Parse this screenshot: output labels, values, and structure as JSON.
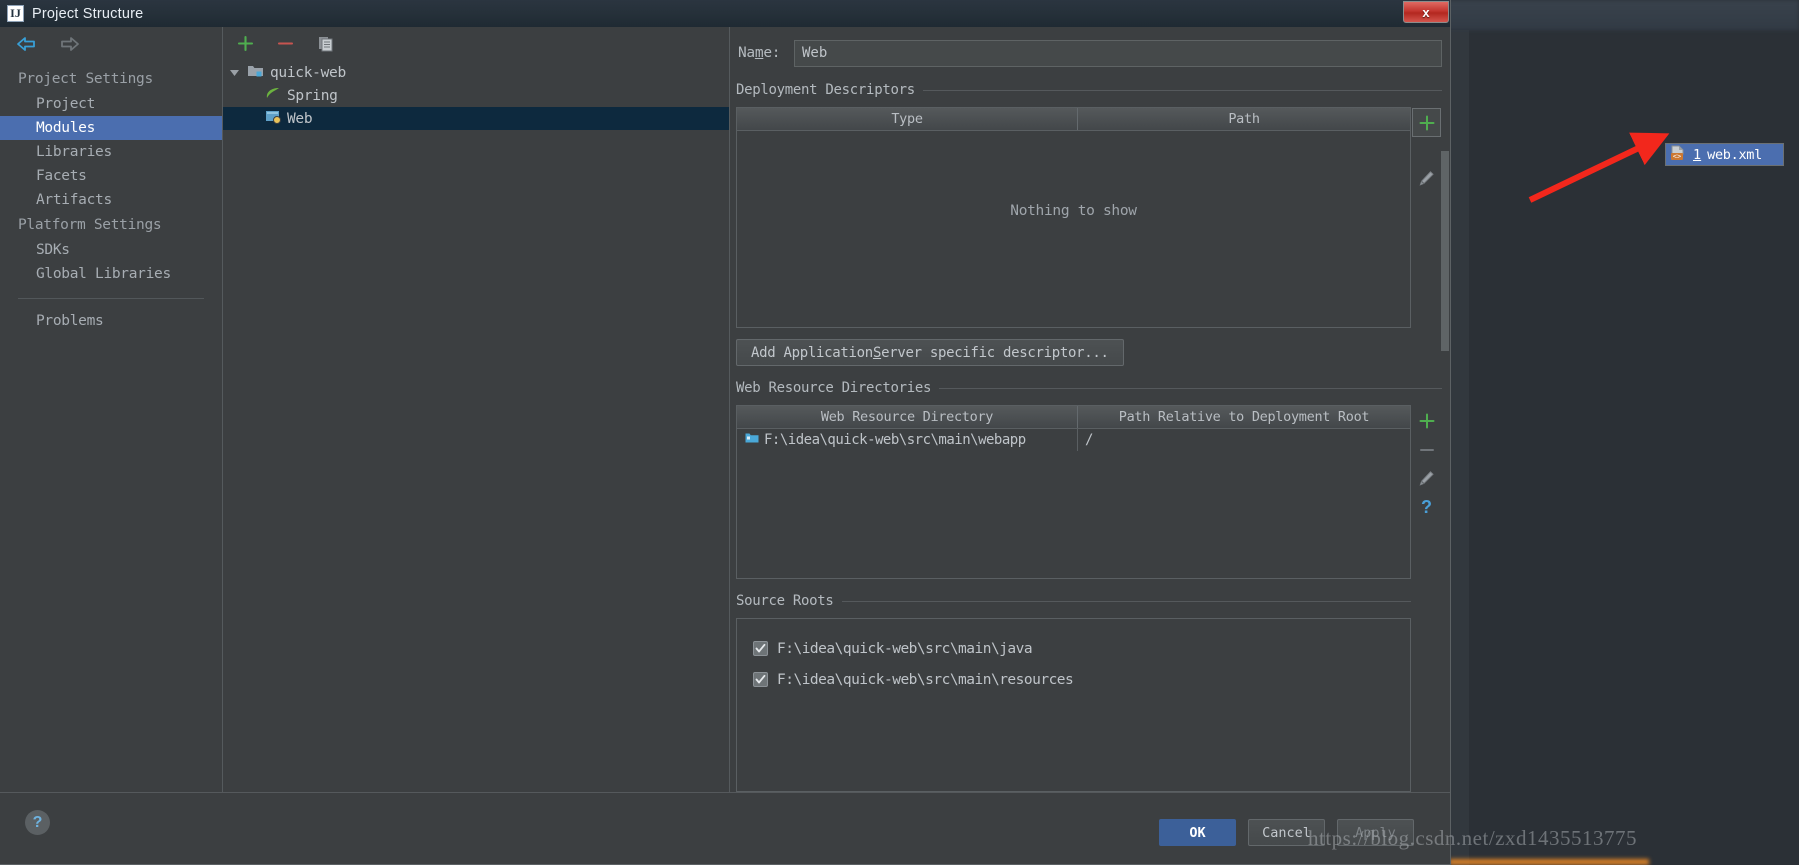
{
  "window": {
    "title": "Project Structure",
    "icon": "idea-logo-icon",
    "close_label": "x"
  },
  "sidebar": {
    "back_icon": "back-arrow-icon",
    "forward_icon": "forward-arrow-icon",
    "groups": [
      {
        "label": "Project Settings",
        "items": [
          {
            "label": "Project",
            "selected": false
          },
          {
            "label": "Modules",
            "selected": true
          },
          {
            "label": "Libraries",
            "selected": false
          },
          {
            "label": "Facets",
            "selected": false
          },
          {
            "label": "Artifacts",
            "selected": false
          }
        ]
      },
      {
        "label": "Platform Settings",
        "items": [
          {
            "label": "SDKs",
            "selected": false
          },
          {
            "label": "Global Libraries",
            "selected": false
          }
        ]
      }
    ],
    "extra": [
      {
        "label": "Problems",
        "selected": false
      }
    ]
  },
  "tree": {
    "toolbar": [
      {
        "name": "add-module-button",
        "icon": "plus-icon"
      },
      {
        "name": "remove-module-button",
        "icon": "minus-icon"
      },
      {
        "name": "copy-module-button",
        "icon": "copy-icon"
      }
    ],
    "nodes": [
      {
        "label": "quick-web",
        "icon": "module-folder-icon",
        "indent": 0,
        "expanded": true,
        "selected": false
      },
      {
        "label": "Spring",
        "icon": "spring-leaf-icon",
        "indent": 1,
        "selected": false
      },
      {
        "label": "Web",
        "icon": "web-facet-icon",
        "indent": 1,
        "selected": true
      }
    ]
  },
  "detail": {
    "name_label_pre": "Na",
    "name_label_accel": "m",
    "name_label_post": "e:",
    "name_value": "Web",
    "name_placeholder": "",
    "deployment": {
      "title": "Deployment Descriptors",
      "columns": [
        "Type",
        "Path"
      ],
      "rows": [],
      "empty_message": "Nothing to show",
      "tools": [
        {
          "name": "add-descriptor-button",
          "icon": "plus-icon"
        },
        {
          "name": "edit-descriptor-button",
          "icon": "pencil-icon"
        }
      ]
    },
    "add_descriptor_button": {
      "pre": "Add Application ",
      "accel": "S",
      "post": "erver specific descriptor..."
    },
    "web_resources": {
      "title": "Web Resource Directories",
      "columns": [
        "Web Resource Directory",
        "Path Relative to Deployment Root"
      ],
      "rows": [
        {
          "directory": "F:\\idea\\quick-web\\src\\main\\webapp",
          "relative_path": "/",
          "icon": "folder-blue-icon"
        }
      ],
      "tools": [
        {
          "name": "add-web-resource-button",
          "icon": "plus-icon"
        },
        {
          "name": "remove-web-resource-button",
          "icon": "minus-icon"
        },
        {
          "name": "edit-web-resource-button",
          "icon": "pencil-icon"
        },
        {
          "name": "web-resource-help-button",
          "icon": "question-icon"
        }
      ]
    },
    "source_roots": {
      "title": "Source Roots",
      "items": [
        {
          "label": "F:\\idea\\quick-web\\src\\main\\java",
          "checked": true
        },
        {
          "label": "F:\\idea\\quick-web\\src\\main\\resources",
          "checked": true
        }
      ]
    }
  },
  "popup": {
    "index": "1",
    "label": "web.xml",
    "icon": "xml-descriptor-icon"
  },
  "footer": {
    "help_icon": "question-icon",
    "buttons": [
      {
        "label": "OK",
        "style": "primary",
        "name": "ok-button"
      },
      {
        "label": "Cancel",
        "style": "normal",
        "name": "cancel-button"
      },
      {
        "label": "Apply",
        "style": "disabled",
        "name": "apply-button"
      }
    ]
  },
  "watermark": {
    "text": "https://blog.csdn.net/zxd1435513775"
  },
  "colors": {
    "selection_blue": "#4b6eaf",
    "tree_selection": "#0d293e",
    "accent_green": "#499c54",
    "accent_red": "#c75450",
    "annotation_red": "#f2271c",
    "primary_button": "#3c6099"
  }
}
